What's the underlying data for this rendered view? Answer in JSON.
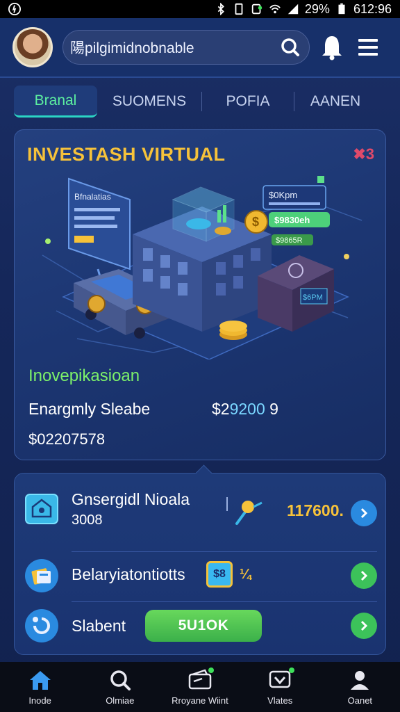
{
  "status_bar": {
    "battery": "29%",
    "time": "612:96"
  },
  "header": {
    "search_value": "陽pilgimidnobnable"
  },
  "tabs": [
    {
      "label": "Branal",
      "active": true
    },
    {
      "label": "SUOMENS",
      "active": false
    },
    {
      "label": "POFIA",
      "active": false
    },
    {
      "label": "AANEN",
      "active": false
    }
  ],
  "hero": {
    "title": "INVESTASH VIRTUAL",
    "close_text": "✖3",
    "screen_text": "Bfnalatias",
    "tag_screen_1": "$0Kpm",
    "tag_screen_2": "$9830eh",
    "tag_screen_3": "$9865R",
    "device_text": "$6PM",
    "subtitle": "Inovepikasioan",
    "row_label": "Enargmly Sleabe",
    "row_amount_a": "$2",
    "row_amount_b": "9200",
    "row_amount_c": "9",
    "total": "$02207578"
  },
  "list": {
    "row1": {
      "title": "Gnsergidl Nioala",
      "sub": "3008",
      "value": "117600."
    },
    "row2": {
      "title": "Belaryiatontiotts",
      "badge": "$8",
      "mark": "¼"
    },
    "row3": {
      "title": "Slabent",
      "button": "5U1OK"
    }
  },
  "nav": [
    {
      "label": "Inode",
      "icon": "home-icon"
    },
    {
      "label": "Olmiae",
      "icon": "search-icon"
    },
    {
      "label": "Rroyane Wiint",
      "icon": "wallet-icon"
    },
    {
      "label": "Vlates",
      "icon": "chat-icon"
    },
    {
      "label": "Oanet",
      "icon": "profile-icon"
    }
  ],
  "colors": {
    "accent_yellow": "#f6c23a",
    "accent_green": "#3cc25a",
    "accent_blue": "#2a8ae0",
    "background": "#17306a"
  }
}
